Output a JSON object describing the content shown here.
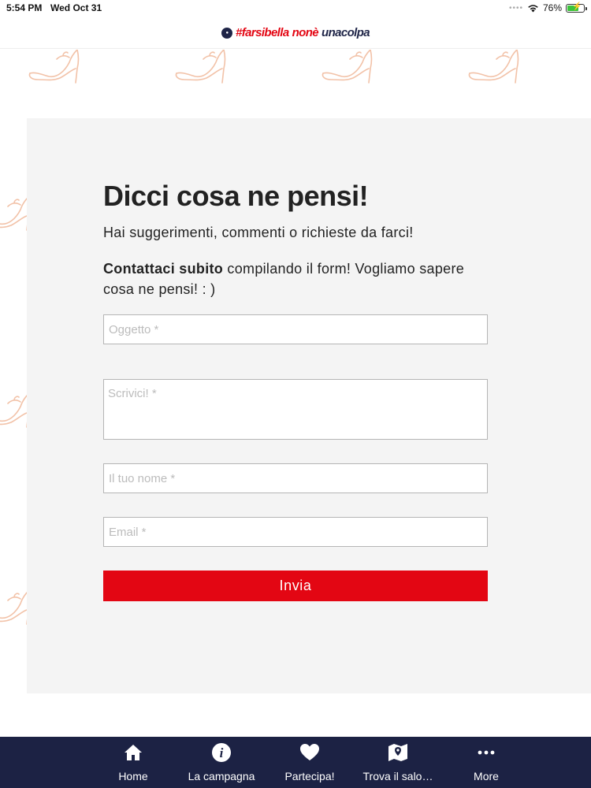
{
  "status_bar": {
    "time": "5:54 PM",
    "date": "Wed Oct 31",
    "signal_dots": "••••",
    "battery": "76%",
    "battery_level": 0.76
  },
  "header": {
    "logo_parts": [
      "#farsibella",
      "nonè",
      "unacolpa"
    ]
  },
  "form": {
    "title": "Dicci cosa ne pensi!",
    "subtitle": "Hai suggerimenti, commenti o richieste da farci!",
    "intro_bold": "Contattaci subito",
    "intro_rest": " compilando il form! Vogliamo sapere cosa ne pensi! : )",
    "fields": {
      "subject_placeholder": "Oggetto *",
      "message_placeholder": "Scrivici! *",
      "name_placeholder": "Il tuo nome *",
      "email_placeholder": "Email *"
    },
    "submit_label": "Invia"
  },
  "colors": {
    "accent": "#e30613",
    "navy": "#1c2244",
    "card": "#f4f4f4",
    "pattern": "#f2c2a8"
  },
  "tabs": [
    {
      "label": "Home",
      "icon": "home-icon"
    },
    {
      "label": "La campagna",
      "icon": "info-icon"
    },
    {
      "label": "Partecipa!",
      "icon": "heart-icon"
    },
    {
      "label": "Trova il salo…",
      "icon": "map-icon"
    },
    {
      "label": "More",
      "icon": "more-icon"
    }
  ]
}
